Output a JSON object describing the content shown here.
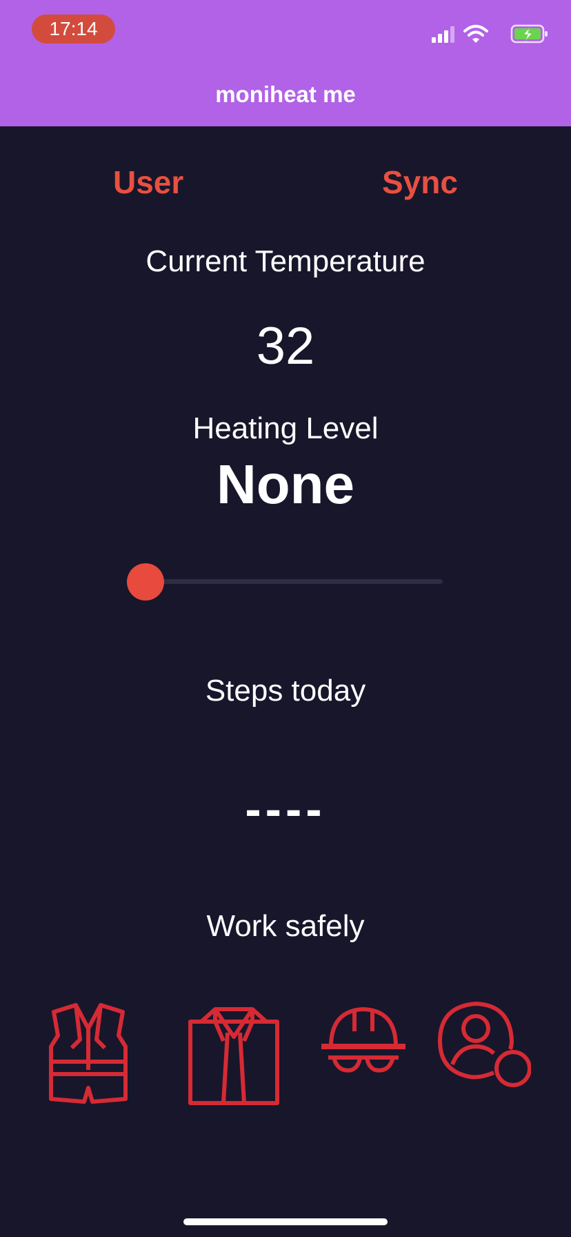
{
  "status_bar": {
    "time": "17:14",
    "icons": [
      "signal-icon",
      "wifi-icon",
      "battery-charging-icon"
    ]
  },
  "app": {
    "title": "moniheat me"
  },
  "nav": {
    "user_label": "User",
    "sync_label": "Sync"
  },
  "temperature": {
    "label": "Current Temperature",
    "value": "32"
  },
  "heating": {
    "label": "Heating Level",
    "value": "None",
    "slider_level": 0
  },
  "steps": {
    "label": "Steps today",
    "value": "----"
  },
  "safety": {
    "label": "Work safely",
    "icons": [
      "safety-vest-icon",
      "work-shirt-icon",
      "hard-hat-icon",
      "user-account-icon"
    ]
  },
  "colors": {
    "header_bg": "#b162e7",
    "background": "#18162b",
    "accent": "#e85040",
    "icon_red": "#d62a34",
    "time_pill": "#d24b3c",
    "battery_green": "#6bd44e"
  }
}
